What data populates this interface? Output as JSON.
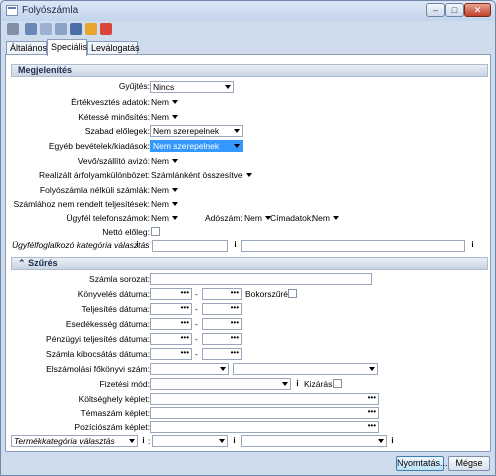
{
  "window": {
    "title": "Folyószámla",
    "min_label": "–",
    "max_label": "□",
    "close_label": "✕"
  },
  "toolbar": {
    "icons": [
      "print-icon",
      "preview-icon",
      "calendar-icon",
      "list-icon",
      "report-icon",
      "export-icon",
      "chart-icon"
    ]
  },
  "tabs": [
    "Általános",
    "Speciális",
    "Leválogatás"
  ],
  "sections": {
    "display": "Megjelenítés",
    "filter": "Szűrés"
  },
  "display": {
    "grouping_label": "Gyűjtés:",
    "grouping_value": "Nincs",
    "value_loss_label": "Értékvesztés adatok:",
    "value_loss_value": "Nem",
    "doubtful_label": "Kétessé minősítés:",
    "doubtful_value": "Nem",
    "free_advance_label": "Szabad előlegek:",
    "free_advance_value": "Nem szerepelnek",
    "other_income_label": "Egyéb bevételek/kiadások:",
    "other_income_value": "Nem szerepelnek",
    "customer_label": "Vevő/szállító avizó:",
    "customer_value": "Nem",
    "fx_label": "Realizált árfolyamkülönbözet:",
    "fx_value": "Számlánként összesítve",
    "no_invoice_label": "Folyószámla nélküli számlák:",
    "no_invoice_value": "Nem",
    "unassigned_label": "Számlához nem rendelt teljesítések:",
    "unassigned_value": "Nem",
    "phone_label": "Ügyfél telefonszámok:",
    "phone_value": "Nem",
    "tax_label": "Adószám:",
    "tax_value": "Nem",
    "address_label": "Címadatok:",
    "address_value": "Nem",
    "net_advance_label": "Nettó előleg:",
    "category_label": "Ügyfélfoglalkozó kategória választás",
    "category_sep": ":"
  },
  "filter": {
    "account_label": "Számla sorozat:",
    "booked_label": "Könyvelés dátuma:",
    "booked_dash": "-",
    "bokor_label": "Bokorszűrés:",
    "perf_label": "Teljesítés dátuma:",
    "perf_dash": "-",
    "due_label": "Esedékesség dátuma:",
    "due_dash": "-",
    "fin_label": "Pénzügyi teljesítés dátuma:",
    "fin_dash": "-",
    "issue_label": "Számla kibocsátás dátuma:",
    "issue_dash": "-",
    "ledger_label": "Elszámolási főkönyvi szám:",
    "payment_label": "Fizetési mód:",
    "excl_label": "Kizárás:",
    "cost_label": "Költséghely képlet:",
    "topic_label": "Témaszám képlet:",
    "pos_label": "Pozíciószám képlet:",
    "prod_label": "Termékkategória választás",
    "prod_sep": ":"
  },
  "buttons": {
    "print": "Nyomtatás...",
    "cancel": "Mégse"
  },
  "icons": {
    "dots": "•••",
    "info": "i",
    "collapse": "⌃"
  }
}
